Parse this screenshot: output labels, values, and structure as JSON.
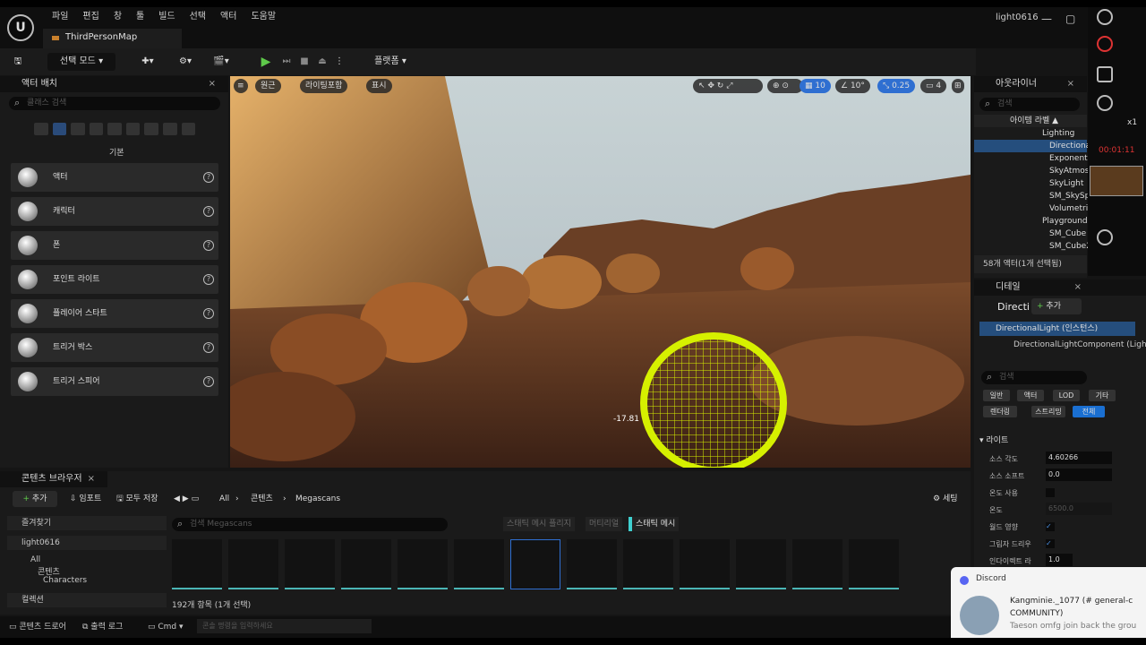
{
  "menu": {
    "logo": "U",
    "items": [
      "파일",
      "편집",
      "창",
      "툴",
      "빌드",
      "선택",
      "액터",
      "도움말"
    ],
    "map_tab": "ThirdPersonMap",
    "project": "light0616"
  },
  "toolbar": {
    "mode": "선택 모드",
    "platform": "플랫폼"
  },
  "place_actors": {
    "title": "액터 배치",
    "search_placeholder": "클래스 검색",
    "category": "기본",
    "items": [
      "액터",
      "캐릭터",
      "폰",
      "포인트 라이트",
      "플레이어 스타트",
      "트리거 박스",
      "트리거 스피어"
    ]
  },
  "viewport": {
    "perspective": "원근",
    "lighting": "라이팅포함",
    "show": "표시",
    "grid": "10",
    "angle": "10°",
    "scale": "0.25",
    "camera": "4",
    "readout": "-17.81"
  },
  "outliner": {
    "title": "아웃라이너",
    "search_placeholder": "검색",
    "column": "아이템 라벨 ▲",
    "rows": [
      "Lighting",
      "Directiona",
      "Exponenti",
      "SkyAtmos",
      "SkyLight",
      "SM_SkySp",
      "Volumetri",
      "Playground",
      "SM_Cube",
      "SM_Cube2"
    ],
    "footer": "58개 액터(1개 선택됨)"
  },
  "details": {
    "title": "디테일",
    "name": "Directi",
    "add": "추가",
    "instance": "DirectionalLight (인스턴스)",
    "component": "DirectionalLightComponent (Light",
    "search_placeholder": "검색",
    "tabs1": [
      "일반",
      "액터",
      "LOD",
      "기타"
    ],
    "tabs2": [
      "렌더링",
      "스트리밍",
      "전체"
    ],
    "section": "라이트",
    "props": [
      {
        "label": "소스 각도",
        "value": "4.60266"
      },
      {
        "label": "소스 소프트",
        "value": "0.0"
      },
      {
        "label": "온도 사용",
        "value": ""
      },
      {
        "label": "온도",
        "value": "6500.0"
      },
      {
        "label": "월드 영향",
        "value": ""
      },
      {
        "label": "그림자 드리우",
        "value": ""
      },
      {
        "label": "인다이렉트 라",
        "value": "1.0"
      }
    ]
  },
  "content": {
    "title": "콘텐츠 브라우저",
    "add": "추가",
    "import": "임포트",
    "save_all": "모두 저장",
    "path": [
      "All",
      "콘텐츠",
      "Megascans"
    ],
    "settings": "세팅",
    "favorites": "즐겨찾기",
    "project": "light0616",
    "tree": [
      "All",
      "콘텐츠",
      "Characters"
    ],
    "collections": "컬렉션",
    "search_placeholder": "검색 Megascans",
    "filters": [
      "스태틱 메시 플리지",
      "머티리얼",
      "스태틱 메시"
    ],
    "count": "192개 항목 (1개 선택)"
  },
  "statusbar": {
    "drawer": "콘텐츠 드로어",
    "output": "출력 로그",
    "cmd": "Cmd",
    "console_placeholder": "콘솔 명령을 입력하세요"
  },
  "recorder": {
    "time": "00:01:11",
    "speed": "x1"
  },
  "discord": {
    "app": "Discord",
    "user": "Kangminie._1077 (#",
    "channel": "general-c",
    "community": "COMMUNITY)",
    "message": "Taeson omfg join back the grou"
  },
  "colors": {
    "accent": "#1a6fd1",
    "selection": "#254e7d",
    "gizmo": "#d6f000"
  }
}
